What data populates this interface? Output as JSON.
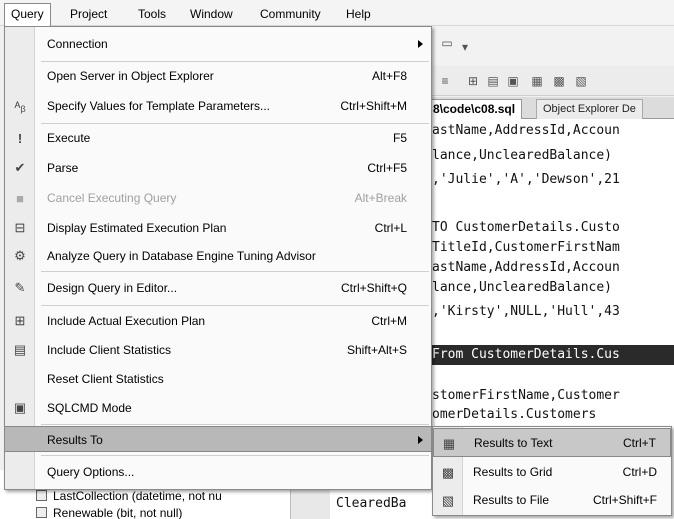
{
  "menubar": {
    "items": [
      "Query",
      "Project",
      "Tools",
      "Window",
      "Community",
      "Help"
    ]
  },
  "editor": {
    "tabs": {
      "active": "8\\code\\c08.sql",
      "inactive": "Object Explorer De"
    },
    "lines": [
      "astName,AddressId,Accoun",
      "lance,UnclearedBalance)",
      ",'Julie','A','Dewson',21",
      "",
      "TO CustomerDetails.Custo",
      "TitleId,CustomerFirstNam",
      "astName,AddressId,Accoun",
      "lance,UnclearedBalance)",
      ",'Kirsty',NULL,'Hull',43",
      "",
      "From CustomerDetails.Cus",
      "",
      "stomerFirstName,Customer",
      "omerDetails.Customers"
    ],
    "bottom_code": "ClearedBa"
  },
  "explorer": {
    "rows": [
      "LastCollection (datetime, not nu",
      "Renewable (bit, not null)"
    ]
  },
  "query_menu": {
    "items": [
      {
        "label": "Connection",
        "shortcut": "",
        "icon": "none"
      },
      {
        "label": "Open Server in Object Explorer",
        "shortcut": "Alt+F8",
        "icon": "none"
      },
      {
        "label": "Specify Values for Template Parameters...",
        "shortcut": "Ctrl+Shift+M",
        "icon": "template-params-icon"
      },
      {
        "label": "Execute",
        "shortcut": "F5",
        "icon": "execute-icon"
      },
      {
        "label": "Parse",
        "shortcut": "Ctrl+F5",
        "icon": "parse-check-icon"
      },
      {
        "label": "Cancel Executing Query",
        "shortcut": "Alt+Break",
        "icon": "stop-icon"
      },
      {
        "label": "Display Estimated Execution Plan",
        "shortcut": "Ctrl+L",
        "icon": "execution-plan-icon"
      },
      {
        "label": "Analyze Query in Database Engine Tuning Advisor",
        "shortcut": "",
        "icon": "tuning-advisor-icon"
      },
      {
        "label": "Design Query in Editor...",
        "shortcut": "Ctrl+Shift+Q",
        "icon": "design-query-icon"
      },
      {
        "label": "Include Actual Execution Plan",
        "shortcut": "Ctrl+M",
        "icon": "actual-plan-icon"
      },
      {
        "label": "Include Client Statistics",
        "shortcut": "Shift+Alt+S",
        "icon": "client-stats-icon"
      },
      {
        "label": "Reset Client Statistics",
        "shortcut": "",
        "icon": "none"
      },
      {
        "label": "SQLCMD Mode",
        "shortcut": "",
        "icon": "sqlcmd-icon"
      },
      {
        "label": "Results To",
        "shortcut": "",
        "icon": "none"
      },
      {
        "label": "Query Options...",
        "shortcut": "",
        "icon": "none"
      }
    ]
  },
  "results_menu": {
    "items": [
      {
        "label": "Results to Text",
        "shortcut": "Ctrl+T",
        "icon": "results-text-icon"
      },
      {
        "label": "Results to Grid",
        "shortcut": "Ctrl+D",
        "icon": "results-grid-icon"
      },
      {
        "label": "Results to File",
        "shortcut": "Ctrl+Shift+F",
        "icon": "results-file-icon"
      }
    ]
  }
}
